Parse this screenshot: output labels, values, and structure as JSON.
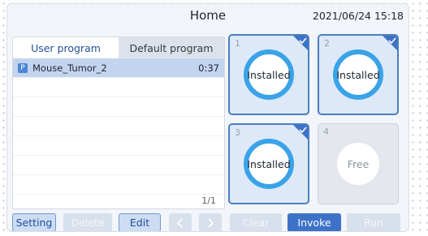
{
  "header": {
    "title": "Home",
    "datetime": "2021/06/24 15:18"
  },
  "program_panel": {
    "tabs": [
      {
        "label": "User program",
        "active": true
      },
      {
        "label": "Default program",
        "active": false
      }
    ],
    "programs": [
      {
        "badge": "P",
        "name": "Mouse_Tumor_2",
        "time": "0:37",
        "selected": true
      }
    ],
    "page_indicator": "1/1"
  },
  "slots": [
    {
      "number": "1",
      "status": "Installed",
      "checked": true
    },
    {
      "number": "2",
      "status": "Installed",
      "checked": true
    },
    {
      "number": "3",
      "status": "Installed",
      "checked": true
    },
    {
      "number": "4",
      "status": "Free",
      "checked": false
    }
  ],
  "toolbar": {
    "setting": "Setting",
    "delete": "Delete",
    "edit": "Edit",
    "prev_icon": "chevron-left-icon",
    "next_icon": "chevron-right-icon",
    "clear": "Clear",
    "invoke": "Invoke",
    "run": "Run"
  },
  "colors": {
    "accent": "#3d72c8",
    "ring_installed": "#3aa3e8",
    "selected_row": "#c3d4ee",
    "installed_border": "#4a7fbf"
  }
}
